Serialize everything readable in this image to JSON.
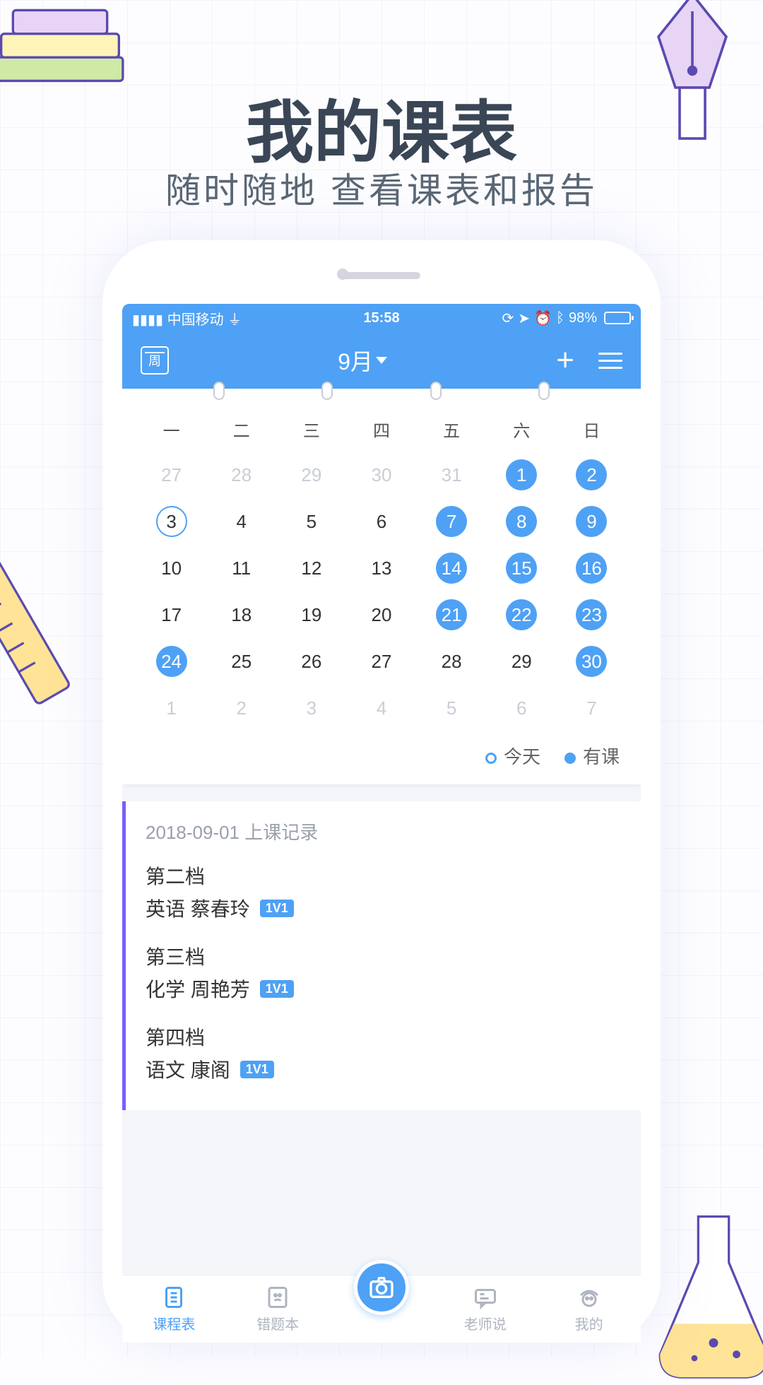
{
  "hero": {
    "title": "我的课表",
    "subtitle": "随时随地 查看课表和报告"
  },
  "statusbar": {
    "carrier": "中国移动",
    "time": "15:58",
    "battery": "98%"
  },
  "header": {
    "calendar_mode": "周",
    "month_label": "9月"
  },
  "calendar": {
    "weekdays": [
      "一",
      "二",
      "三",
      "四",
      "五",
      "六",
      "日"
    ],
    "rows": [
      [
        {
          "d": "27",
          "dim": true
        },
        {
          "d": "28",
          "dim": true
        },
        {
          "d": "29",
          "dim": true
        },
        {
          "d": "30",
          "dim": true
        },
        {
          "d": "31",
          "dim": true
        },
        {
          "d": "1",
          "event": true
        },
        {
          "d": "2",
          "event": true
        }
      ],
      [
        {
          "d": "3",
          "today": true
        },
        {
          "d": "4"
        },
        {
          "d": "5"
        },
        {
          "d": "6"
        },
        {
          "d": "7",
          "event": true
        },
        {
          "d": "8",
          "event": true
        },
        {
          "d": "9",
          "event": true
        }
      ],
      [
        {
          "d": "10"
        },
        {
          "d": "11"
        },
        {
          "d": "12"
        },
        {
          "d": "13"
        },
        {
          "d": "14",
          "event": true
        },
        {
          "d": "15",
          "event": true
        },
        {
          "d": "16",
          "event": true
        }
      ],
      [
        {
          "d": "17"
        },
        {
          "d": "18"
        },
        {
          "d": "19"
        },
        {
          "d": "20"
        },
        {
          "d": "21",
          "event": true
        },
        {
          "d": "22",
          "event": true
        },
        {
          "d": "23",
          "event": true
        }
      ],
      [
        {
          "d": "24",
          "event": true
        },
        {
          "d": "25"
        },
        {
          "d": "26"
        },
        {
          "d": "27"
        },
        {
          "d": "28"
        },
        {
          "d": "29"
        },
        {
          "d": "30",
          "event": true
        }
      ],
      [
        {
          "d": "1",
          "dim": true
        },
        {
          "d": "2",
          "dim": true
        },
        {
          "d": "3",
          "dim": true
        },
        {
          "d": "4",
          "dim": true
        },
        {
          "d": "5",
          "dim": true
        },
        {
          "d": "6",
          "dim": true
        },
        {
          "d": "7",
          "dim": true
        }
      ]
    ],
    "legend": {
      "today": "今天",
      "has_class": "有课"
    }
  },
  "record": {
    "title": "2018-09-01 上课记录",
    "badge": "1V1",
    "slots": [
      {
        "tier": "第二档",
        "subject": "英语",
        "teacher": "蔡春玲"
      },
      {
        "tier": "第三档",
        "subject": "化学",
        "teacher": "周艳芳"
      },
      {
        "tier": "第四档",
        "subject": "语文",
        "teacher": "康阁"
      }
    ]
  },
  "nav": {
    "items": [
      "课程表",
      "错题本",
      "",
      "老师说",
      "我的"
    ],
    "active_index": 0
  }
}
